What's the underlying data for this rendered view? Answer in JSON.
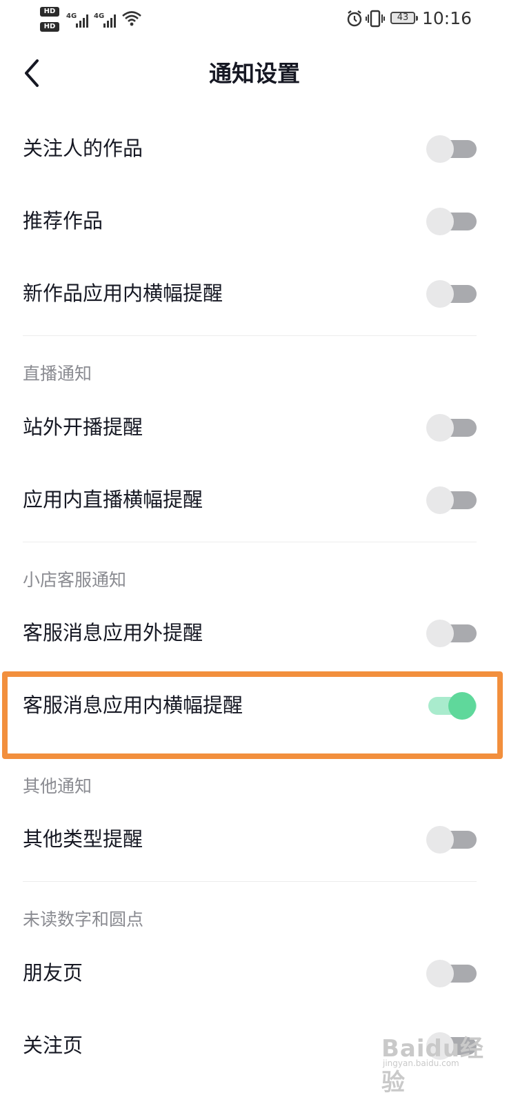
{
  "status_bar": {
    "hd1": "HD",
    "hd2": "HD",
    "net1": "4G",
    "net2": "4G",
    "battery": "43",
    "time": "10:16"
  },
  "header": {
    "title": "通知设置"
  },
  "rows": {
    "follow_works": {
      "label": "关注人的作品",
      "enabled": false
    },
    "recommended_works": {
      "label": "推荐作品",
      "enabled": false
    },
    "new_works_banner": {
      "label": "新作品应用内横幅提醒",
      "enabled": false
    },
    "live_offsite": {
      "label": "站外开播提醒",
      "enabled": false
    },
    "live_banner": {
      "label": "应用内直播横幅提醒",
      "enabled": false
    },
    "cs_outside": {
      "label": "客服消息应用外提醒",
      "enabled": false
    },
    "cs_banner": {
      "label": "客服消息应用内横幅提醒",
      "enabled": true
    },
    "other_types": {
      "label": "其他类型提醒",
      "enabled": false
    },
    "friends_page": {
      "label": "朋友页",
      "enabled": false
    },
    "follow_page": {
      "label": "关注页",
      "enabled": false
    }
  },
  "sections": {
    "live": "直播通知",
    "shop_cs": "小店客服通知",
    "other": "其他通知",
    "unread": "未读数字和圆点"
  },
  "watermark": {
    "text": "Baidu经验",
    "sub": "jingyan.baidu.com"
  },
  "colors": {
    "toggle_on_knob": "#5fd89b",
    "toggle_on_track": "#a9ebcd",
    "toggle_off_track": "#a9aaae",
    "toggle_off_knob": "#e8e8e9",
    "highlight": "#f28f3d"
  }
}
